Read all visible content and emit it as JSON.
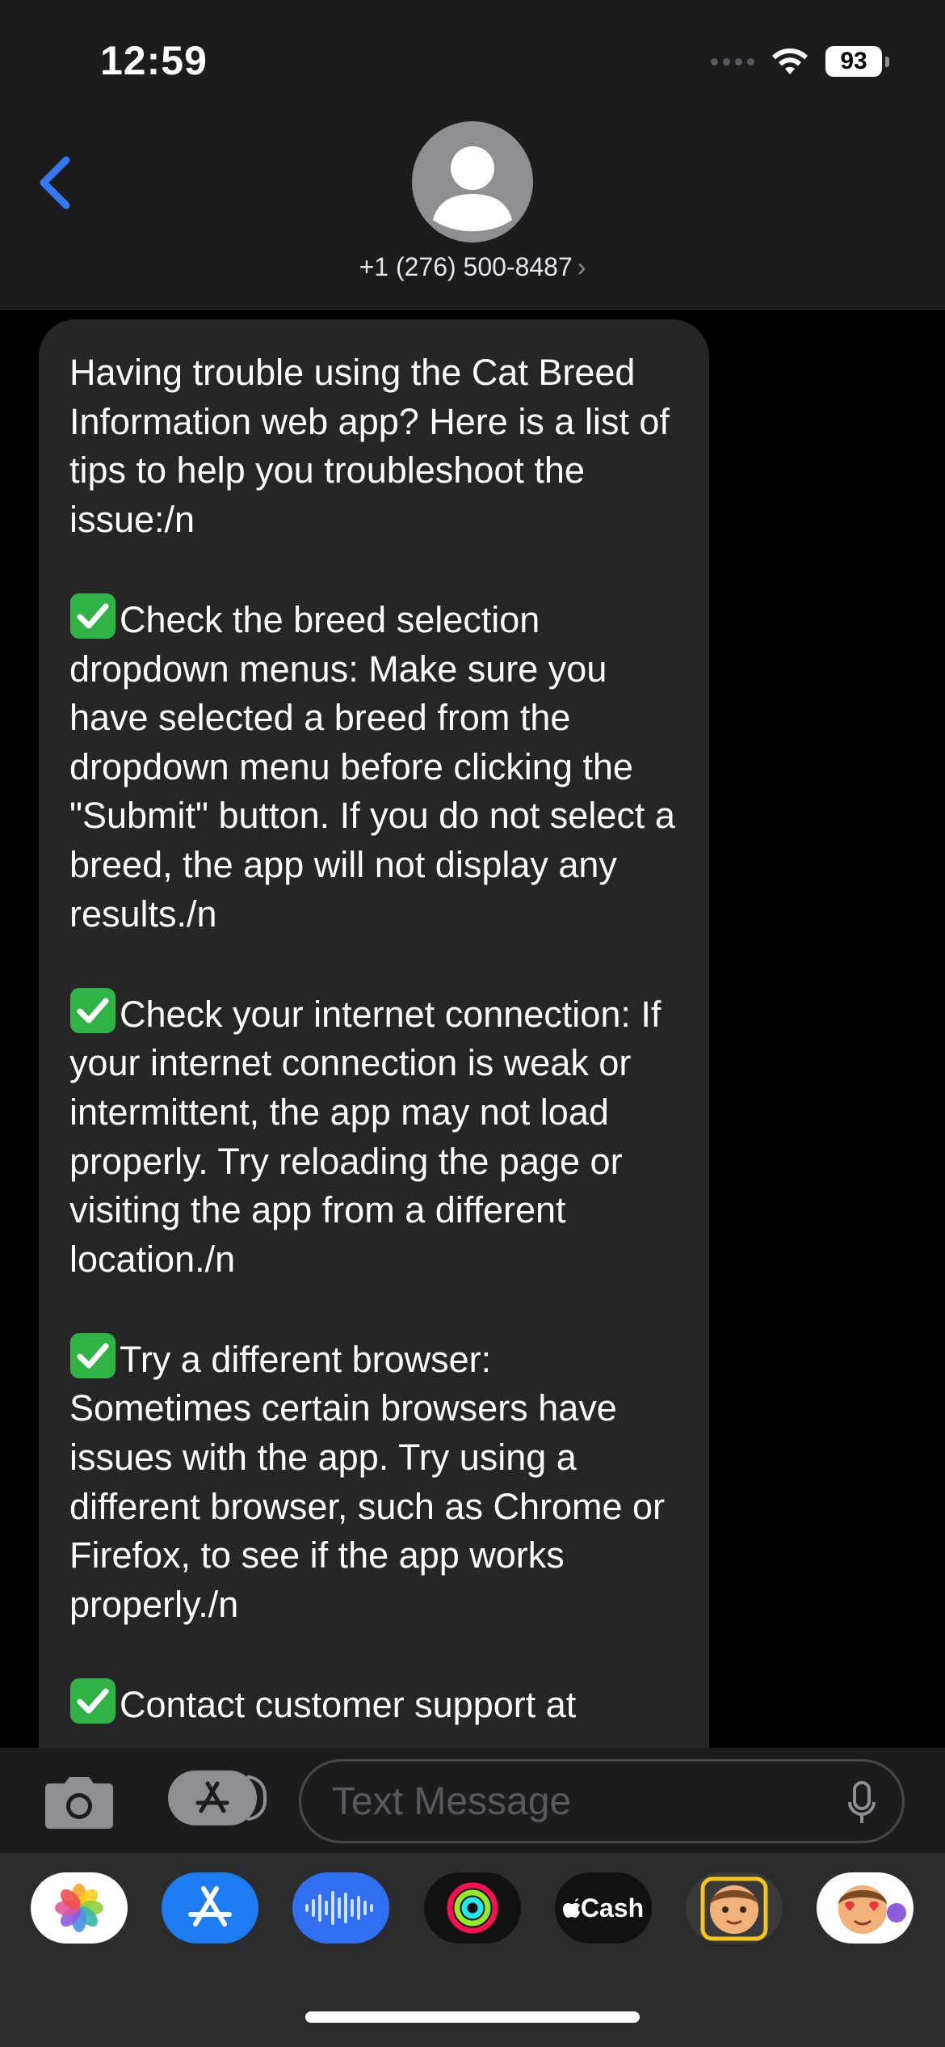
{
  "status_bar": {
    "time": "12:59",
    "battery": "93"
  },
  "header": {
    "contact": "+1 (276) 500-8487",
    "chevron": "›"
  },
  "message": {
    "text": "Having trouble using the Cat Breed Information web app? Here is a list of tips to help you troubleshoot the issue:/n\n\n✅Check the breed selection dropdown menus: Make sure you have selected a breed from the dropdown menu before clicking the \"Submit\" button. If you do not select a breed, the app will not display any results./n\n\n✅Check your internet connection: If your internet connection is weak or intermittent, the app may not load properly. Try reloading the page or visiting the app from a different location./n\n\n✅Try a different browser: Sometimes certain browsers have issues with the app. Try using a different browser, such as Chrome or Firefox, to see if the app works properly./n\n\n✅Contact customer support at"
  },
  "composer": {
    "placeholder": "Text Message"
  },
  "app_strip": {
    "apps": [
      {
        "name": "photos-icon"
      },
      {
        "name": "app-store-icon"
      },
      {
        "name": "audio-message-icon"
      },
      {
        "name": "activity-icon"
      },
      {
        "name": "apple-cash-icon",
        "label": "Cash"
      },
      {
        "name": "memoji-icon"
      },
      {
        "name": "memoji-stickers-icon"
      }
    ]
  },
  "colors": {
    "accent": "#3478f6",
    "bubble": "#262628",
    "header": "#1c1c1e"
  }
}
